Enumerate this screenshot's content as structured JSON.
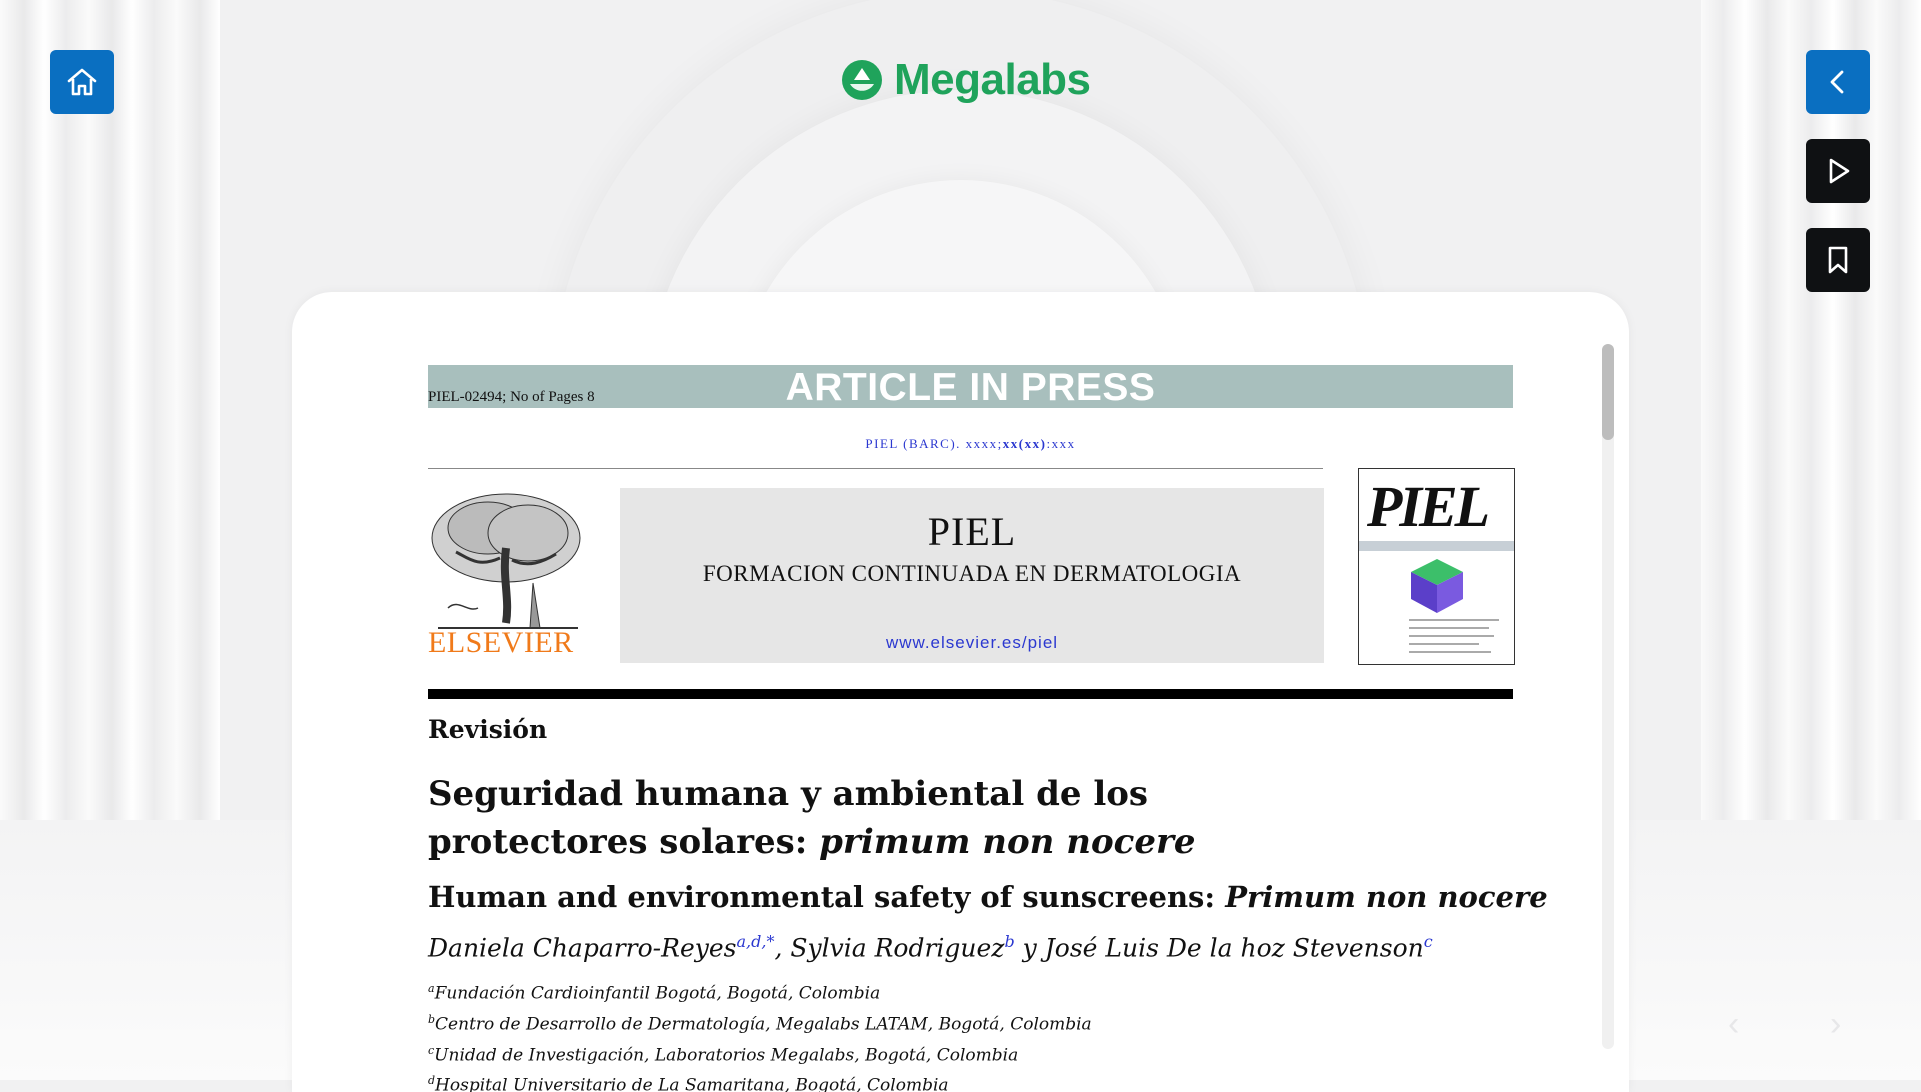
{
  "brand": {
    "name": "Megalabs",
    "color": "#1fa35b"
  },
  "nav": {
    "home_icon": "home-icon",
    "back_icon": "chevron-left-icon",
    "play_icon": "play-icon",
    "bookmark_icon": "bookmark-icon",
    "blue": "#0a6fc1",
    "dark": "#0f1113"
  },
  "document": {
    "press_left": "PIEL-02494; No of Pages 8",
    "press_title": "ARTICLE IN PRESS",
    "journal_line_pre": "PIEL (BARC). xxxx;",
    "journal_line_bold": "xx(xx)",
    "journal_line_post": ":xxx",
    "publisher_logo_text": "ELSEVIER",
    "masthead_title": "PIEL",
    "masthead_subtitle": "FORMACION CONTINUADA EN DERMATOLOGIA",
    "masthead_url": "www.elsevier.es/piel",
    "cover_title": "PIEL",
    "article_type": "Revisión",
    "title_es_main": "Seguridad humana y ambiental de los protectores solares: ",
    "title_es_italic": "primum non nocere",
    "title_en_main": "Human and environmental safety of sunscreens: ",
    "title_en_italic": "Primum non nocere",
    "authors": [
      {
        "name": "Daniela Chaparro-Reyes",
        "marks": "a,d,*",
        "sep": ", "
      },
      {
        "name": "Sylvia Rodriguez",
        "marks": "b",
        "sep": " y "
      },
      {
        "name": "José Luis De la hoz Stevenson",
        "marks": "c",
        "sep": ""
      }
    ],
    "affiliations": [
      {
        "mark": "a",
        "text": "Fundación Cardioinfantil Bogotá, Bogotá, Colombia"
      },
      {
        "mark": "b",
        "text": "Centro de Desarrollo de Dermatología, Megalabs LATAM, Bogotá, Colombia"
      },
      {
        "mark": "c",
        "text": "Unidad de Investigación, Laboratorios Megalabs, Bogotá, Colombia"
      },
      {
        "mark": "d",
        "text": "Hospital Universitario de La Samaritana, Bogotá, Colombia"
      }
    ]
  }
}
